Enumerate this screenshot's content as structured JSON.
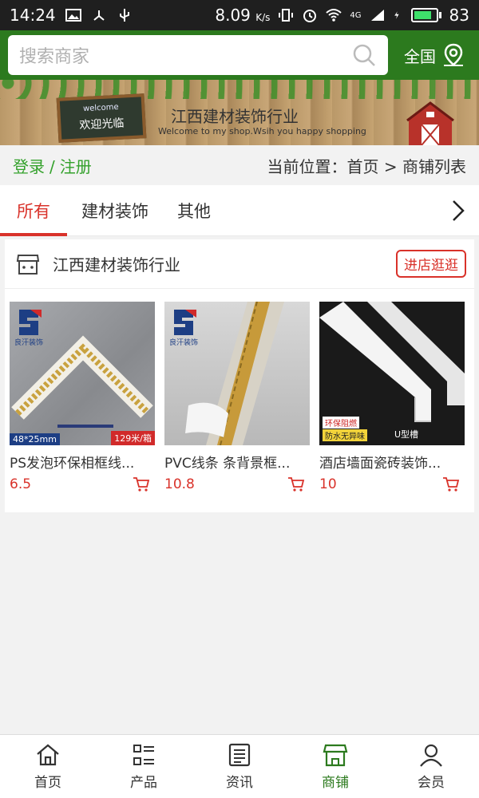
{
  "status_bar": {
    "time": "14:24",
    "speed": "8.09",
    "speed_unit": "K/s",
    "battery": "83",
    "battery_level": 0.83,
    "network": "4G"
  },
  "header": {
    "search_placeholder": "搜索商家",
    "region_label": "全国",
    "icons": [
      "search-icon",
      "location-pin-icon"
    ]
  },
  "banner": {
    "title": "江西建材装饰行业",
    "subtitle": "Welcome to my shop.Wsih you happy shopping",
    "board_welcome": "welcome",
    "board_text": "欢迎光临"
  },
  "crumbs": {
    "login": "登录",
    "separator": "/",
    "register": "注册",
    "position": "当前位置：首页 > 商铺列表"
  },
  "tabs": [
    {
      "label": "所有",
      "active": true
    },
    {
      "label": "建材装饰",
      "active": false
    },
    {
      "label": "其他",
      "active": false
    }
  ],
  "shop": {
    "name": "江西建材装饰行业",
    "visit_label": "进店逛逛",
    "products": [
      {
        "name": "PS发泡环保相框线...",
        "price": "6.5",
        "brand": "良汗装饰",
        "tag_left": "48*25mm",
        "tag_right": "129米/箱"
      },
      {
        "name": "PVC线条 条背景框...",
        "price": "10.8",
        "brand": "良汗装饰"
      },
      {
        "name": "酒店墙面瓷砖装饰...",
        "price": "10",
        "tag1": "环保阻燃",
        "tag2": "防水无异味",
        "tag3": "U型槽"
      }
    ]
  },
  "bottom_nav": [
    {
      "label": "首页",
      "icon": "home-icon",
      "active": false
    },
    {
      "label": "产品",
      "icon": "list-icon",
      "active": false
    },
    {
      "label": "资讯",
      "icon": "news-icon",
      "active": false
    },
    {
      "label": "商铺",
      "icon": "store-icon",
      "active": true
    },
    {
      "label": "会员",
      "icon": "user-icon",
      "active": false
    }
  ],
  "colors": {
    "brand_green": "#2c7a1e",
    "accent_red": "#d9322a",
    "link_green": "#33a12b"
  }
}
